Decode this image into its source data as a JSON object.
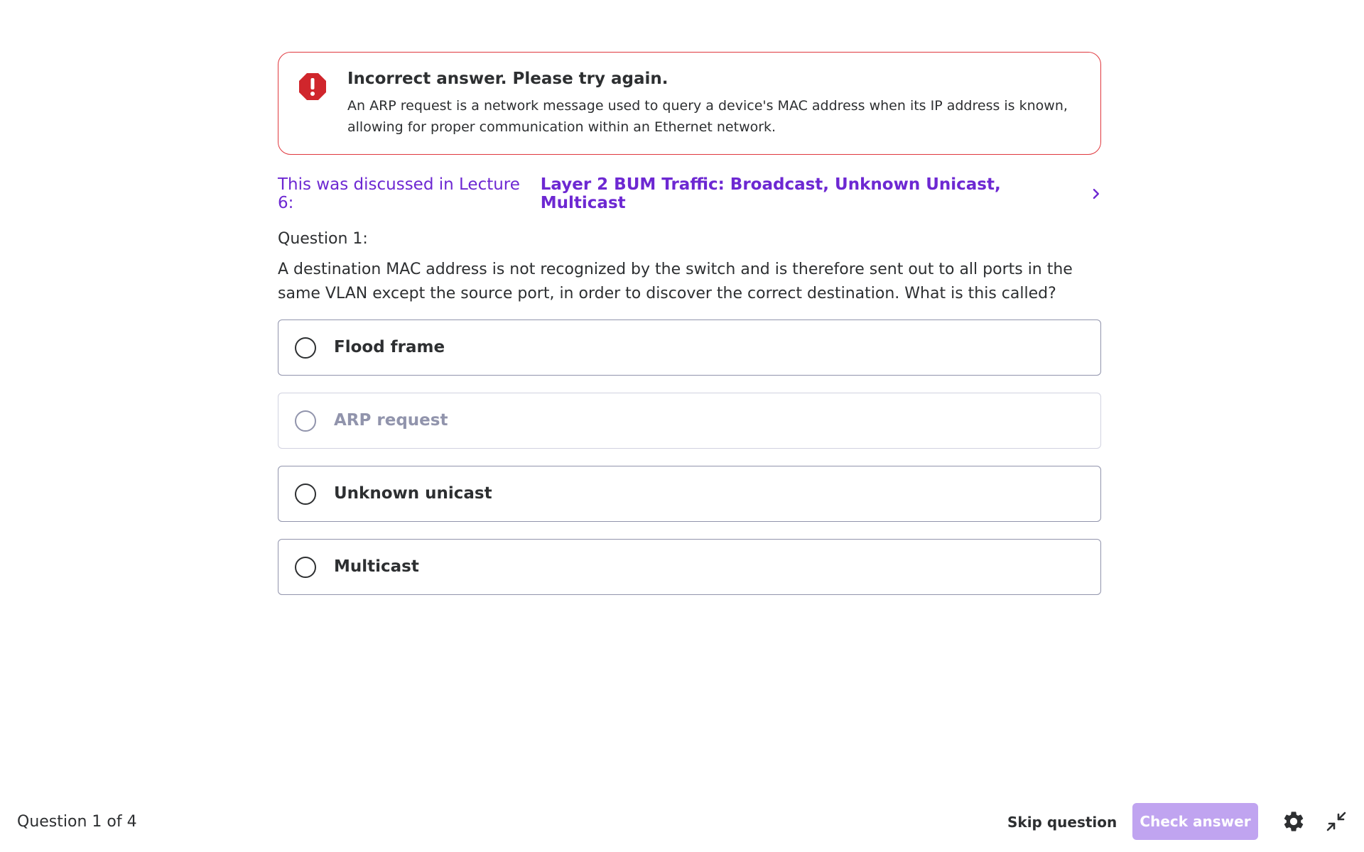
{
  "alert": {
    "icon": "error-octagon-icon",
    "title": "Incorrect answer. Please try again.",
    "body": "An ARP request is a network message used to query a device's MAC address when its IP address is known, allowing for proper communication within an Ethernet network."
  },
  "lecture": {
    "prefix": "This was discussed in Lecture 6:",
    "title": "Layer 2 BUM Traffic: Broadcast, Unknown Unicast, Multicast",
    "icon": "chevron-right-icon"
  },
  "question": {
    "label": "Question 1:",
    "text": "A destination MAC address is not recognized by the switch and is therefore sent out to all ports in the same VLAN except the source port, in order to discover the correct destination. What is this called?"
  },
  "options": [
    {
      "label": "Flood frame",
      "disabled": false
    },
    {
      "label": "ARP request",
      "disabled": true
    },
    {
      "label": "Unknown unicast",
      "disabled": false
    },
    {
      "label": "Multicast",
      "disabled": false
    }
  ],
  "footer": {
    "progress": "Question 1 of 4",
    "skip_label": "Skip question",
    "check_label": "Check answer",
    "settings_icon": "gear-icon",
    "collapse_icon": "minimize-icon"
  },
  "colors": {
    "error": "#e0383e",
    "accent": "#6d28d2",
    "check_button_disabled": "#c0a4f0"
  }
}
